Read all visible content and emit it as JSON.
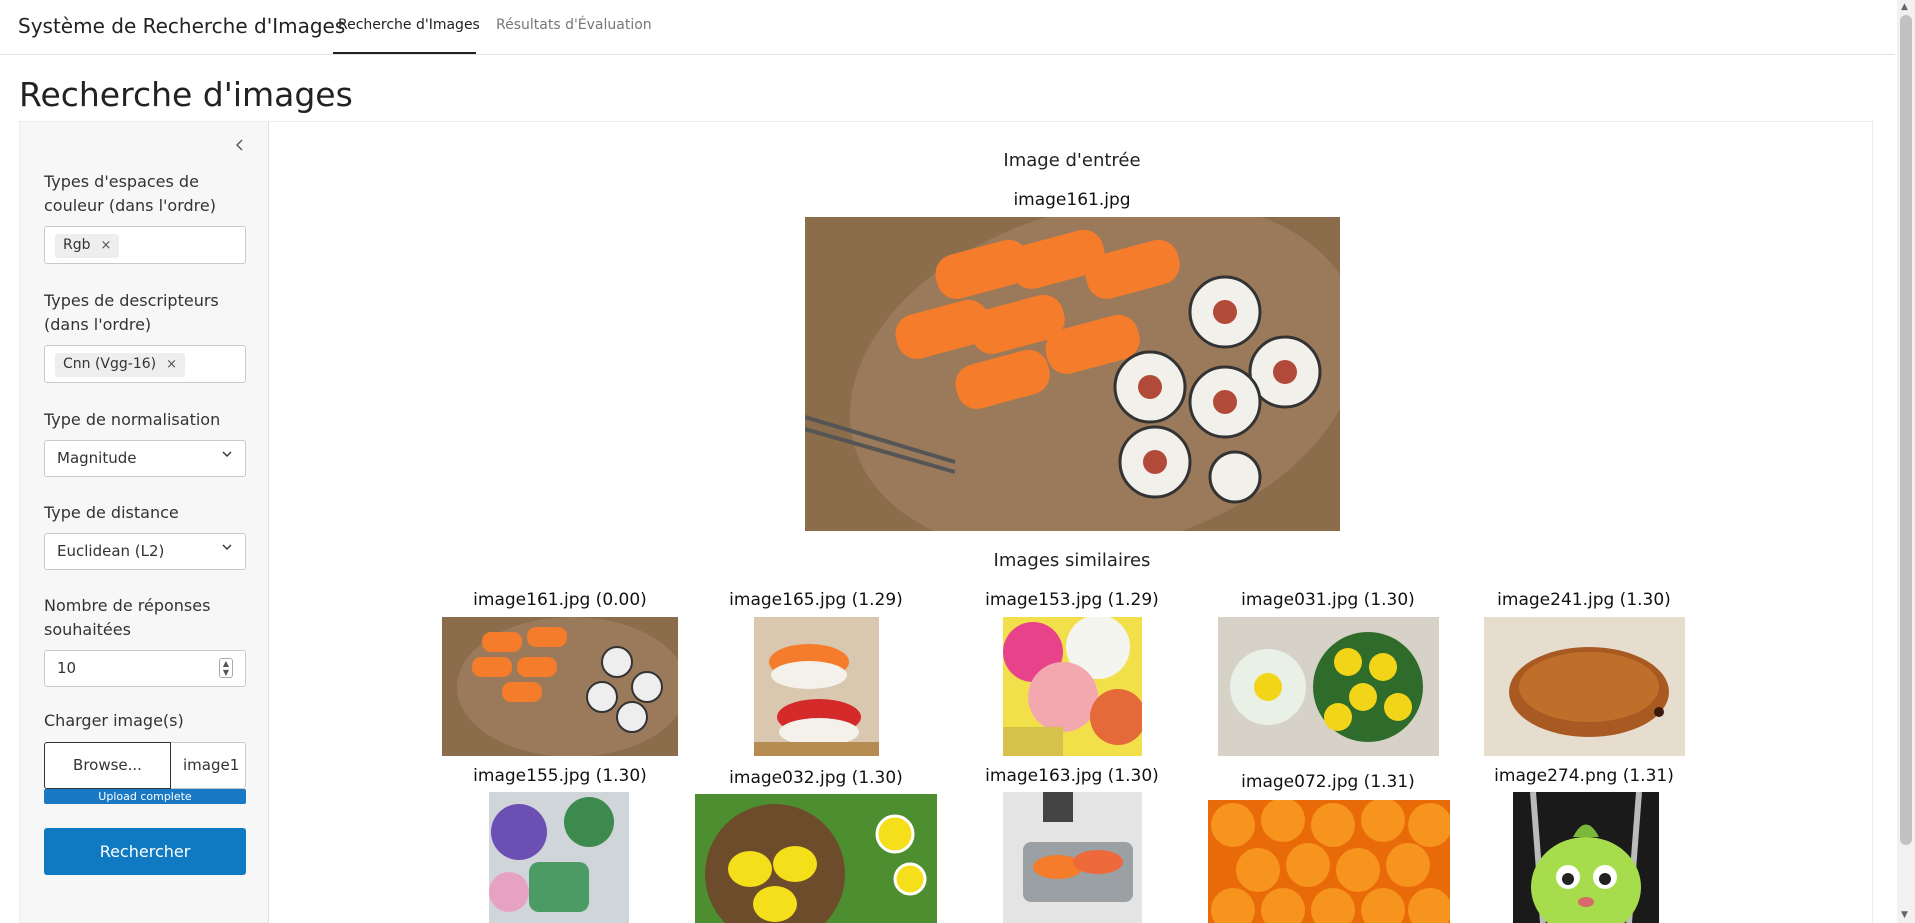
{
  "header": {
    "brand": "Système de Recherche d'Images",
    "tabs": [
      {
        "label": "Recherche d'Images",
        "active": true
      },
      {
        "label": "Résultats d'Évaluation",
        "active": false
      }
    ]
  },
  "page_title": "Recherche d'images",
  "sidebar": {
    "color_spaces_label": "Types d'espaces de couleur (dans l'ordre)",
    "color_space_chip": "Rgb",
    "descriptors_label": "Types de descripteurs (dans l'ordre)",
    "descriptor_chip": "Cnn (Vgg-16)",
    "normalisation_label": "Type de normalisation",
    "normalisation_value": "Magnitude",
    "distance_label": "Type de distance",
    "distance_value": "Euclidean (L2)",
    "responses_label": "Nombre de réponses souhaitées",
    "responses_value": "10",
    "upload_label": "Charger image(s)",
    "browse_label": "Browse...",
    "file_name": "image1",
    "upload_status": "Upload complete",
    "search_button": "Rechercher"
  },
  "main": {
    "input_title": "Image d'entrée",
    "input_filename": "image161.jpg",
    "similar_title": "Images similaires",
    "results": [
      {
        "label": "image161.jpg (0.00)"
      },
      {
        "label": "image165.jpg (1.29)"
      },
      {
        "label": "image153.jpg (1.29)"
      },
      {
        "label": "image031.jpg (1.30)"
      },
      {
        "label": "image241.jpg (1.30)"
      },
      {
        "label": "image155.jpg (1.30)"
      },
      {
        "label": "image032.jpg (1.30)"
      },
      {
        "label": "image163.jpg (1.30)"
      },
      {
        "label": "image072.jpg (1.31)"
      },
      {
        "label": "image274.png (1.31)"
      }
    ]
  },
  "colors": {
    "primary": "#0f79c1",
    "progress": "#1a79c5",
    "sidebar_bg": "#f7f7f7"
  }
}
